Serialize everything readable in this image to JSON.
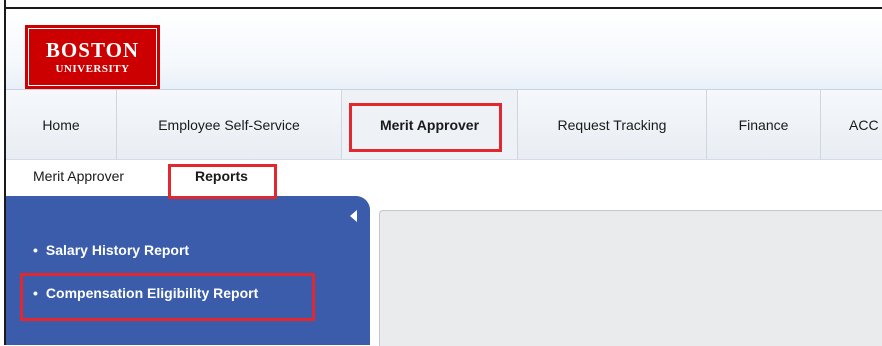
{
  "logo": {
    "line1": "BOSTON",
    "line2": "UNIVERSITY"
  },
  "tabs": [
    {
      "label": "Home"
    },
    {
      "label": "Employee Self-Service"
    },
    {
      "label": "Merit Approver"
    },
    {
      "label": "Request Tracking"
    },
    {
      "label": "Finance"
    },
    {
      "label": "ACC"
    }
  ],
  "subnav": [
    {
      "label": "Merit Approver"
    },
    {
      "label": "Reports"
    }
  ],
  "sidebar": {
    "items": [
      {
        "label": "Salary History Report"
      },
      {
        "label": "Compensation Eligibility Report"
      }
    ]
  },
  "colors": {
    "logo_red": "#cc0000",
    "sidebar_blue": "#3a5caa",
    "highlight_red": "#e0282e"
  }
}
